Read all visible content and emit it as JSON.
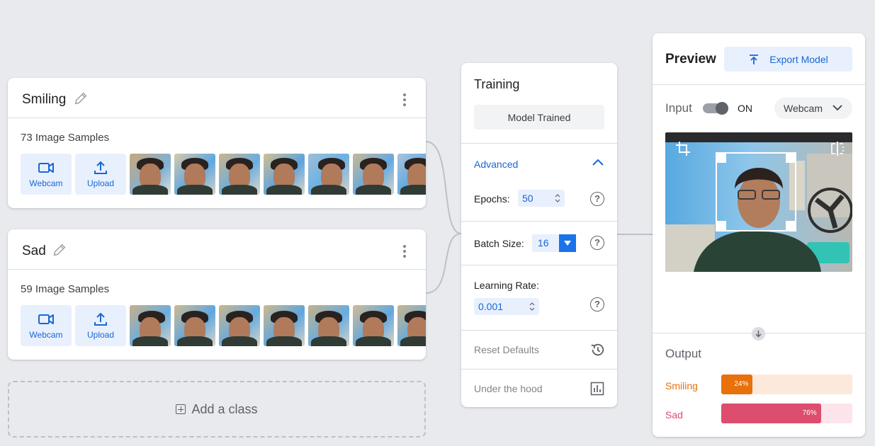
{
  "classes": [
    {
      "name": "Smiling",
      "samples_label": "73 Image Samples",
      "webcam_label": "Webcam",
      "upload_label": "Upload"
    },
    {
      "name": "Sad",
      "samples_label": "59 Image Samples",
      "webcam_label": "Webcam",
      "upload_label": "Upload"
    }
  ],
  "add_class_label": "Add a class",
  "training": {
    "title": "Training",
    "train_button": "Model Trained",
    "advanced_label": "Advanced",
    "epochs_label": "Epochs:",
    "epochs_value": "50",
    "batch_label": "Batch Size:",
    "batch_value": "16",
    "lr_label": "Learning Rate:",
    "lr_value": "0.001",
    "reset_label": "Reset Defaults",
    "hood_label": "Under the hood",
    "help_glyph": "?"
  },
  "preview": {
    "title": "Preview",
    "export_label": "Export Model",
    "input_label": "Input",
    "toggle_state": "ON",
    "source_value": "Webcam",
    "output_label": "Output",
    "outputs": [
      {
        "name": "Smiling",
        "percent_label": "24%",
        "value": 24,
        "color": "#e8710a",
        "track": "#fde9dc"
      },
      {
        "name": "Sad",
        "percent_label": "76%",
        "value": 76,
        "color": "#dd4d6d",
        "track": "#fce4ea"
      }
    ]
  },
  "colors": {
    "accent": "#1967d2",
    "smiling": "#e8710a",
    "sad": "#dd4d6d"
  }
}
